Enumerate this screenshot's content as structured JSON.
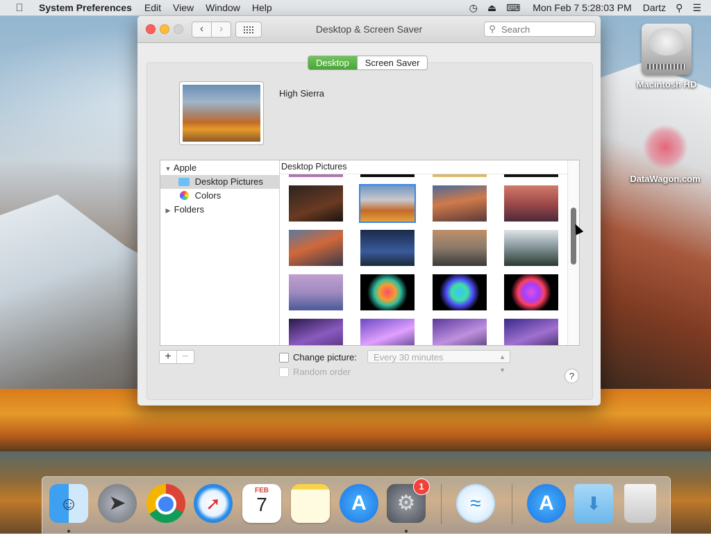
{
  "menubar": {
    "apple_icon": "apple-logo-icon",
    "app_name": "System Preferences",
    "menus": [
      "Edit",
      "View",
      "Window",
      "Help"
    ],
    "status_icons": [
      "time-machine-icon",
      "eject-icon",
      "input-menu-icon"
    ],
    "clock": "Mon Feb 7  5:28:03 PM",
    "user": "Dartz"
  },
  "desktop": {
    "hd_label": "Macintosh HD",
    "datawagon_label": "DataWagon.com"
  },
  "window": {
    "title": "Desktop & Screen Saver",
    "search_placeholder": "Search",
    "tabs": [
      {
        "label": "Desktop",
        "active": true
      },
      {
        "label": "Screen Saver",
        "active": false
      }
    ],
    "current_wallpaper": "High Sierra",
    "source_list": {
      "apple": "Apple",
      "desktop_pictures": "Desktop Pictures",
      "colors": "Colors",
      "folders": "Folders"
    },
    "grid_header": "Desktop Pictures",
    "add_label": "+",
    "remove_label": "−",
    "change_picture_label": "Change picture:",
    "interval_value": "Every 30 minutes",
    "random_order_label": "Random order",
    "help_label": "?"
  },
  "dock": {
    "apps": [
      "Finder",
      "Launchpad",
      "Google Chrome",
      "Safari",
      "Calendar",
      "Notes",
      "App Store",
      "System Preferences",
      "Wi-Fi Explorer",
      "App Store Downloads",
      "Downloads",
      "Trash"
    ],
    "calendar_month": "FEB",
    "calendar_day": "7",
    "sysprefs_badge": "1"
  },
  "colors": {
    "active_tab": "#4aa53a",
    "badge": "#f0413a",
    "close": "#fc605b",
    "minimize": "#fdbc40"
  }
}
